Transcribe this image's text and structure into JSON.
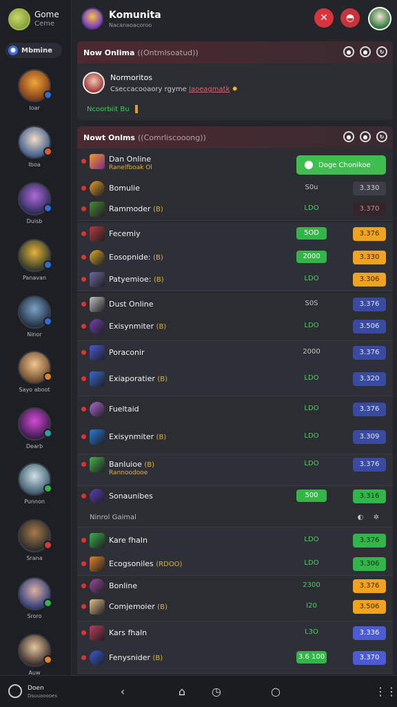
{
  "app": {
    "title": "Gome",
    "subtitle": "Ceme"
  },
  "sidebar": {
    "members_label": "Mbmine",
    "members": [
      {
        "name": "Ioar",
        "badge": "#2e6cd8",
        "colors": [
          "#f2a63a",
          "#7b3a17"
        ]
      },
      {
        "name": "Iboa",
        "badge": "#e05b2a",
        "colors": [
          "#f0dcc6",
          "#3a5a8a"
        ]
      },
      {
        "name": "Duisb",
        "badge": "#2e6cd8",
        "colors": [
          "#b06ad6",
          "#2a2a5a"
        ]
      },
      {
        "name": "Panavan",
        "badge": "#2e6cd8",
        "colors": [
          "#e5b13a",
          "#2f3a2a"
        ]
      },
      {
        "name": "Ninor",
        "badge": "#2e6cd8",
        "colors": [
          "#7aa0c6",
          "#203040"
        ]
      },
      {
        "name": "Sayo aboot",
        "badge": "#e0842a",
        "colors": [
          "#f3c58e",
          "#6a4a2a"
        ]
      },
      {
        "name": "Dearb",
        "badge": "#2aa0a0",
        "colors": [
          "#d44ad6",
          "#3a1a4a"
        ]
      },
      {
        "name": "Punnon",
        "badge": "#3ab04a",
        "colors": [
          "#cfe0e8",
          "#3a5a6a"
        ]
      },
      {
        "name": "Srana",
        "badge": "#d33b3b",
        "colors": [
          "#a87a4a",
          "#2a2a2a"
        ]
      },
      {
        "name": "Sroro",
        "badge": "#3ab04a",
        "colors": [
          "#e0b0a0",
          "#2a3a7a"
        ]
      },
      {
        "name": "Auw",
        "badge": "#e0842a",
        "colors": [
          "#e3c79c",
          "#3a2a2a"
        ]
      }
    ]
  },
  "header": {
    "title": "Komunita",
    "subtitle": "Nacanaoacoroo"
  },
  "card1": {
    "title": "Now Onlima",
    "subtitle": "(Ontmlsoatud)",
    "featured_name": "Normoritos",
    "featured_desc": "Cseccacooaory rgyme",
    "featured_link": "Iaoeagmatk",
    "status_text": "Ncoorbiit  Bu"
  },
  "card2": {
    "title": "Nowt Onlms",
    "subtitle": "(Comrliscooong)",
    "first_row_title": "Dan Online",
    "first_row_sub": "Ranelfboak Ol",
    "button_label": "Doge Chonikoe"
  },
  "rows": [
    {
      "label": "Bomulie",
      "hint": "",
      "value": "S0u",
      "value_style": "plain",
      "num": "3.330",
      "num_style": "gray"
    },
    {
      "label": "Rammoder",
      "hint": "(B)",
      "value": "LDO",
      "value_style": "green",
      "num": "3.370",
      "num_style": "dark"
    },
    {
      "label": "Fecemiy",
      "hint": "",
      "value": "5OD",
      "value_style": "pill-green",
      "num": "3.376",
      "num_style": "orange"
    },
    {
      "label": "Eosopnide:",
      "hint": "(B)",
      "value": "2000",
      "value_style": "pill-green",
      "num": "3.330",
      "num_style": "orange"
    },
    {
      "label": "Patyemioe:",
      "hint": "(B)",
      "value": "LDO",
      "value_style": "green",
      "num": "3.306",
      "num_style": "orange"
    },
    {
      "label": "Dust Online",
      "hint": "",
      "value": "S0S",
      "value_style": "plain",
      "num": "3.376",
      "num_style": "blue"
    },
    {
      "label": "Exisynmiter",
      "hint": "(B)",
      "value": "LDO",
      "value_style": "green",
      "num": "3.506",
      "num_style": "blue"
    },
    {
      "label": "Poraconir",
      "hint": "",
      "value": "2000",
      "value_style": "plain",
      "num": "3.376",
      "num_style": "blue"
    },
    {
      "label": "Exiaporatier",
      "hint": "(B)",
      "value": "LDO",
      "value_style": "green",
      "num": "3.320",
      "num_style": "blue"
    },
    {
      "label": "Fueltaid",
      "hint": "",
      "value": "LDO",
      "value_style": "green",
      "num": "3.376",
      "num_style": "blue"
    },
    {
      "label": "Exisynmiter",
      "hint": "(B)",
      "value": "LDO",
      "value_style": "green",
      "num": "3.309",
      "num_style": "blue"
    },
    {
      "label": "Banluioe",
      "hint": "(B)",
      "sub": "Rannoodooe",
      "value": "LDO",
      "value_style": "green",
      "num": "3.376",
      "num_style": "blue"
    },
    {
      "label": "Sonaunibes",
      "hint": "",
      "value": "500",
      "value_style": "pill-green",
      "num": "3.316",
      "num_style": "green"
    },
    {
      "label": "Kare fhaln",
      "hint": "",
      "value": "LDO",
      "value_style": "green",
      "num": "3.376",
      "num_style": "green"
    },
    {
      "label": "Ecogsoniles",
      "hint": "(RDOO)",
      "value": "LDO",
      "value_style": "green",
      "num": "3.306",
      "num_style": "green"
    },
    {
      "label": "Bonline",
      "hint": "",
      "value": "2300",
      "value_style": "green",
      "num": "3.376",
      "num_style": "orange"
    },
    {
      "label": "Comjemoier",
      "hint": "(B)",
      "value": "I20",
      "value_style": "green",
      "num": "3.506",
      "num_style": "orange"
    },
    {
      "label": "Kars fhaln",
      "hint": "",
      "value": "L3O",
      "value_style": "green",
      "num": "3.336",
      "num_style": "vblue"
    },
    {
      "label": "Fenysnider",
      "hint": "(B)",
      "value": "3.6 100",
      "value_style": "pill-green",
      "num": "3.370",
      "num_style": "vblue"
    }
  ],
  "extra_row": {
    "label": "Ninrol Gaimal"
  },
  "bottom": {
    "title": "Doen",
    "subtitle": "Dsuuaoooes"
  }
}
